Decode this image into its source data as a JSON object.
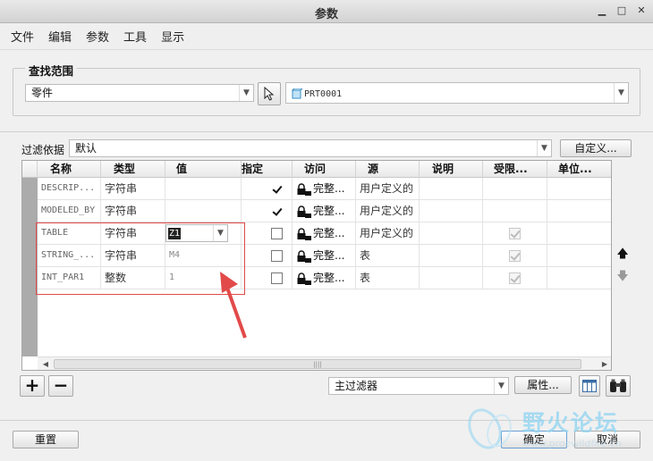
{
  "window": {
    "title": "参数",
    "minimize": "▁",
    "maximize": "□",
    "close": "✕"
  },
  "menu": [
    "文件",
    "编辑",
    "参数",
    "工具",
    "显示"
  ],
  "search_scope": {
    "label": "查找范围",
    "type_value": "零件",
    "model_value": "PRT0001"
  },
  "filter": {
    "label": "过滤依据",
    "value": "默认",
    "customize_label": "自定义..."
  },
  "table": {
    "columns": [
      "名称",
      "类型",
      "值",
      "指定",
      "访问",
      "源",
      "说明",
      "受限...",
      "单位..."
    ],
    "rows": [
      {
        "name": "DESCRIP...",
        "type": "字符串",
        "value": "",
        "designated": true,
        "access": "完整...",
        "source": "用户定义的",
        "restricted": false,
        "editable": true
      },
      {
        "name": "MODELED_BY",
        "type": "字符串",
        "value": "",
        "designated": true,
        "access": "完整...",
        "source": "用户定义的",
        "restricted": false,
        "editable": true
      },
      {
        "name": "TABLE",
        "type": "字符串",
        "value": "Z1",
        "designated": false,
        "access": "完整...",
        "source": "用户定义的",
        "restricted": true,
        "editable": false
      },
      {
        "name": "STRING_...",
        "type": "字符串",
        "value": "M4",
        "designated": false,
        "access": "完整...",
        "source": "表",
        "restricted": true,
        "editable": false
      },
      {
        "name": "INT_PAR1",
        "type": "整数",
        "value": "1",
        "designated": false,
        "access": "完整...",
        "source": "表",
        "restricted": true,
        "editable": false
      }
    ],
    "hscroll_grip": "||||"
  },
  "toolbar": {
    "add_label": "+",
    "remove_label": "−",
    "main_filter_value": "主过滤器",
    "properties_label": "属性..."
  },
  "footer": {
    "reset_label": "重置",
    "ok_label": "确定",
    "cancel_label": "取消"
  },
  "watermark": {
    "text": "野火论坛",
    "url": "www.proewildfire.cn"
  },
  "colors": {
    "annotation_red": "#e24a4a",
    "watermark_blue": "#8ed3f2"
  }
}
